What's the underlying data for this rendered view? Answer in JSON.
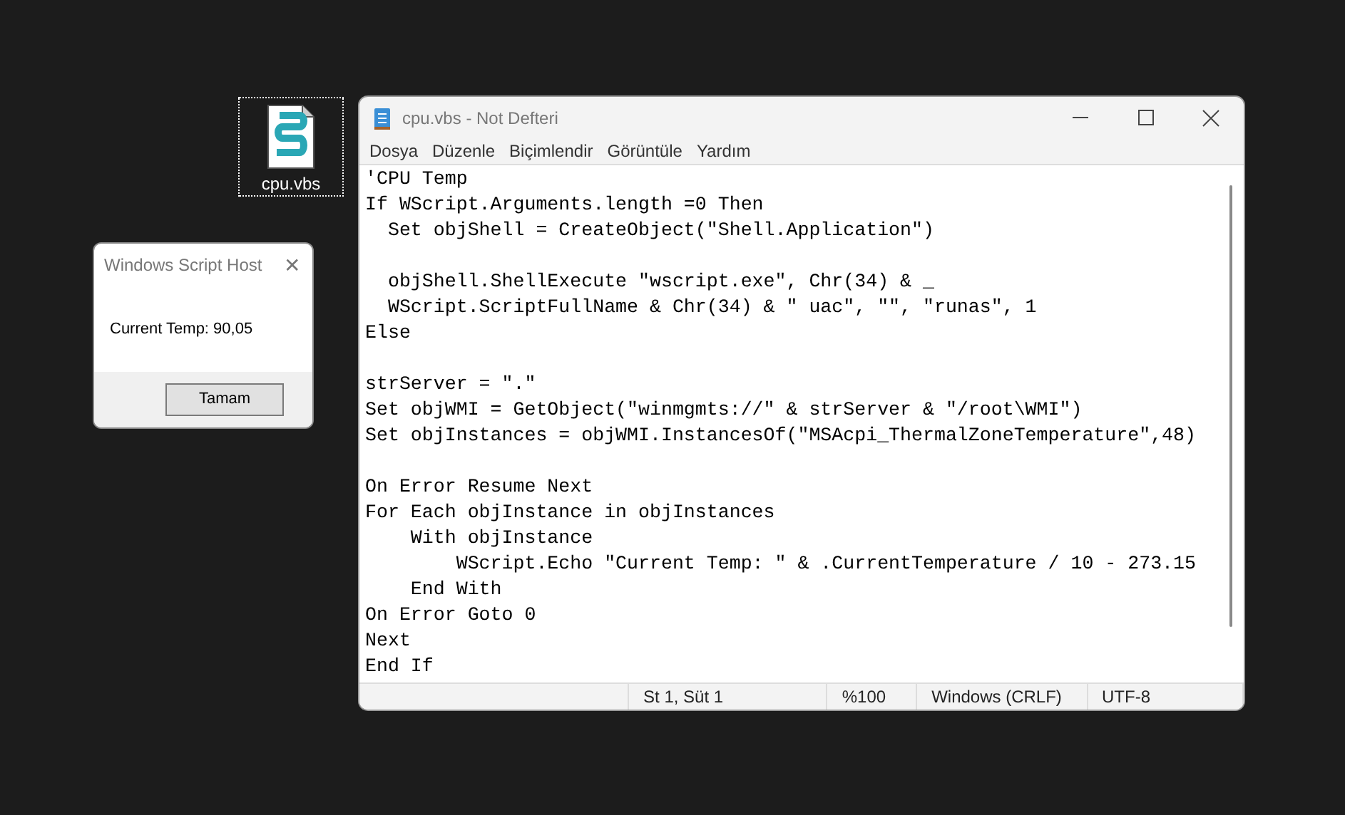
{
  "desktop_icon": {
    "label": "cpu.vbs",
    "selected": true
  },
  "dialog": {
    "title": "Windows Script Host",
    "close": "✕",
    "message": "Current Temp: 90,05",
    "button": "Tamam"
  },
  "notepad": {
    "title": "cpu.vbs - Not Defteri",
    "menu": [
      "Dosya",
      "Düzenle",
      "Biçimlendir",
      "Görüntüle",
      "Yardım"
    ],
    "content": "'CPU Temp\nIf WScript.Arguments.length =0 Then\n  Set objShell = CreateObject(\"Shell.Application\")\n\n  objShell.ShellExecute \"wscript.exe\", Chr(34) & _\n  WScript.ScriptFullName & Chr(34) & \" uac\", \"\", \"runas\", 1\nElse\n\nstrServer = \".\"\nSet objWMI = GetObject(\"winmgmts://\" & strServer & \"/root\\WMI\")\nSet objInstances = objWMI.InstancesOf(\"MSAcpi_ThermalZoneTemperature\",48)\n\nOn Error Resume Next\nFor Each objInstance in objInstances\n    With objInstance\n        WScript.Echo \"Current Temp: \" & .CurrentTemperature / 10 - 273.15\n    End With\nOn Error Goto 0\nNext\nEnd If",
    "status": [
      "St 1, Süt 1",
      "%100",
      "Windows (CRLF)",
      "UTF-8"
    ]
  }
}
